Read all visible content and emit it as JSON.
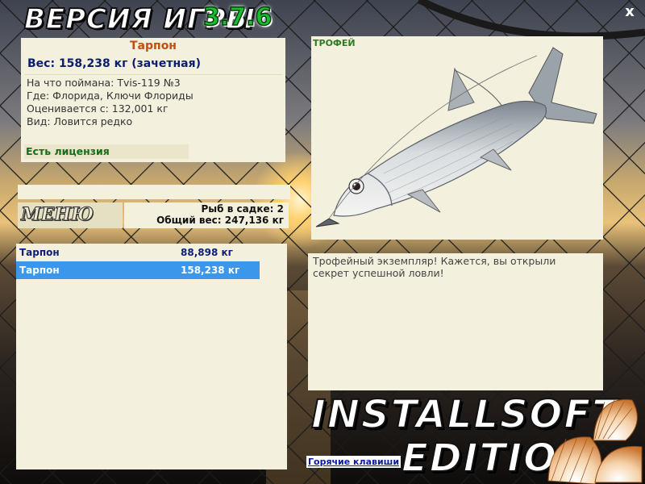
{
  "header": {
    "title": "ВЕРСИЯ ИГРЫ",
    "version": "3.7.6",
    "close_label": "x"
  },
  "fish": {
    "name": "Тарпон",
    "weight": "Вес: 158,238 кг (зачетная)",
    "caught_with": "На что поймана: Tvis-119 №3",
    "location": "Где: Флорида, Ключи Флориды",
    "rated_from": "Оценивается с: 132,001 кг",
    "kind": "Вид: Ловится редко",
    "license": "Есть лицензия"
  },
  "menu": {
    "label": "МЕНЮ",
    "fish_count": "Рыб в садке: 2",
    "total_weight": "Общий вес: 247,136 кг"
  },
  "catch_list": [
    {
      "name": "Тарпон",
      "weight": "88,898 кг",
      "selected": false
    },
    {
      "name": "Тарпон",
      "weight": "158,238 кг",
      "selected": true
    }
  ],
  "trophy": {
    "label": "ТРОФЕЙ",
    "image": "tarpon-fish-illustration",
    "description": "Трофейный экземпляр! Кажется, вы открыли секрет успешной ловли!"
  },
  "footer": {
    "brand_line1": "INSTALLSOFT",
    "brand_line2": "EDITION",
    "hotkeys_label": "Горячие клавиши"
  },
  "colors": {
    "panel_bg": "#f3f0dd",
    "fish_name": "#c05012",
    "weight_text": "#0b1d6e",
    "license_text": "#1a6b1a",
    "selected_row": "#3a97ec",
    "version_green": "#18c030"
  }
}
